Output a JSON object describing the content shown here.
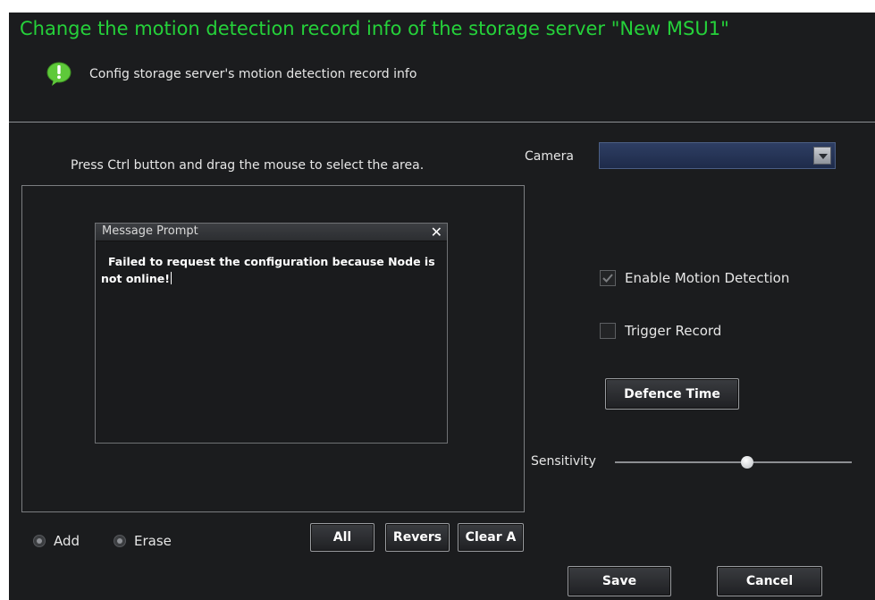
{
  "header": {
    "title": "Change the motion detection record info of the storage server \"New MSU1\"",
    "subtitle": "Config storage server's motion detection record info"
  },
  "area": {
    "hint": "Press Ctrl button and drag the mouse to select the area."
  },
  "dialog": {
    "title": "Message Prompt",
    "message": "Failed to request the configuration because Node is not online!"
  },
  "camera": {
    "label": "Camera",
    "selected": ""
  },
  "options": {
    "enable_motion_detection": {
      "label": "Enable Motion Detection",
      "checked": true
    },
    "trigger_record": {
      "label": "Trigger Record",
      "checked": false
    }
  },
  "defence_time_label": "Defence Time",
  "sensitivity": {
    "label": "Sensitivity",
    "level_fraction": 0.55
  },
  "mode": {
    "add_label": "Add",
    "erase_label": "Erase",
    "selected": "Add"
  },
  "area_buttons": {
    "all": "All",
    "revers": "Revers",
    "clear": "Clear A"
  },
  "footer": {
    "save": "Save",
    "cancel": "Cancel"
  },
  "colors": {
    "title_green": "#25d13a",
    "panel_bg": "#1b1c1e",
    "icon_green": "#5ec93a"
  },
  "icons": {
    "info": "exclamation-bubble-icon",
    "close": "close-icon",
    "dropdown": "chevron-down-icon",
    "check": "check-icon"
  }
}
